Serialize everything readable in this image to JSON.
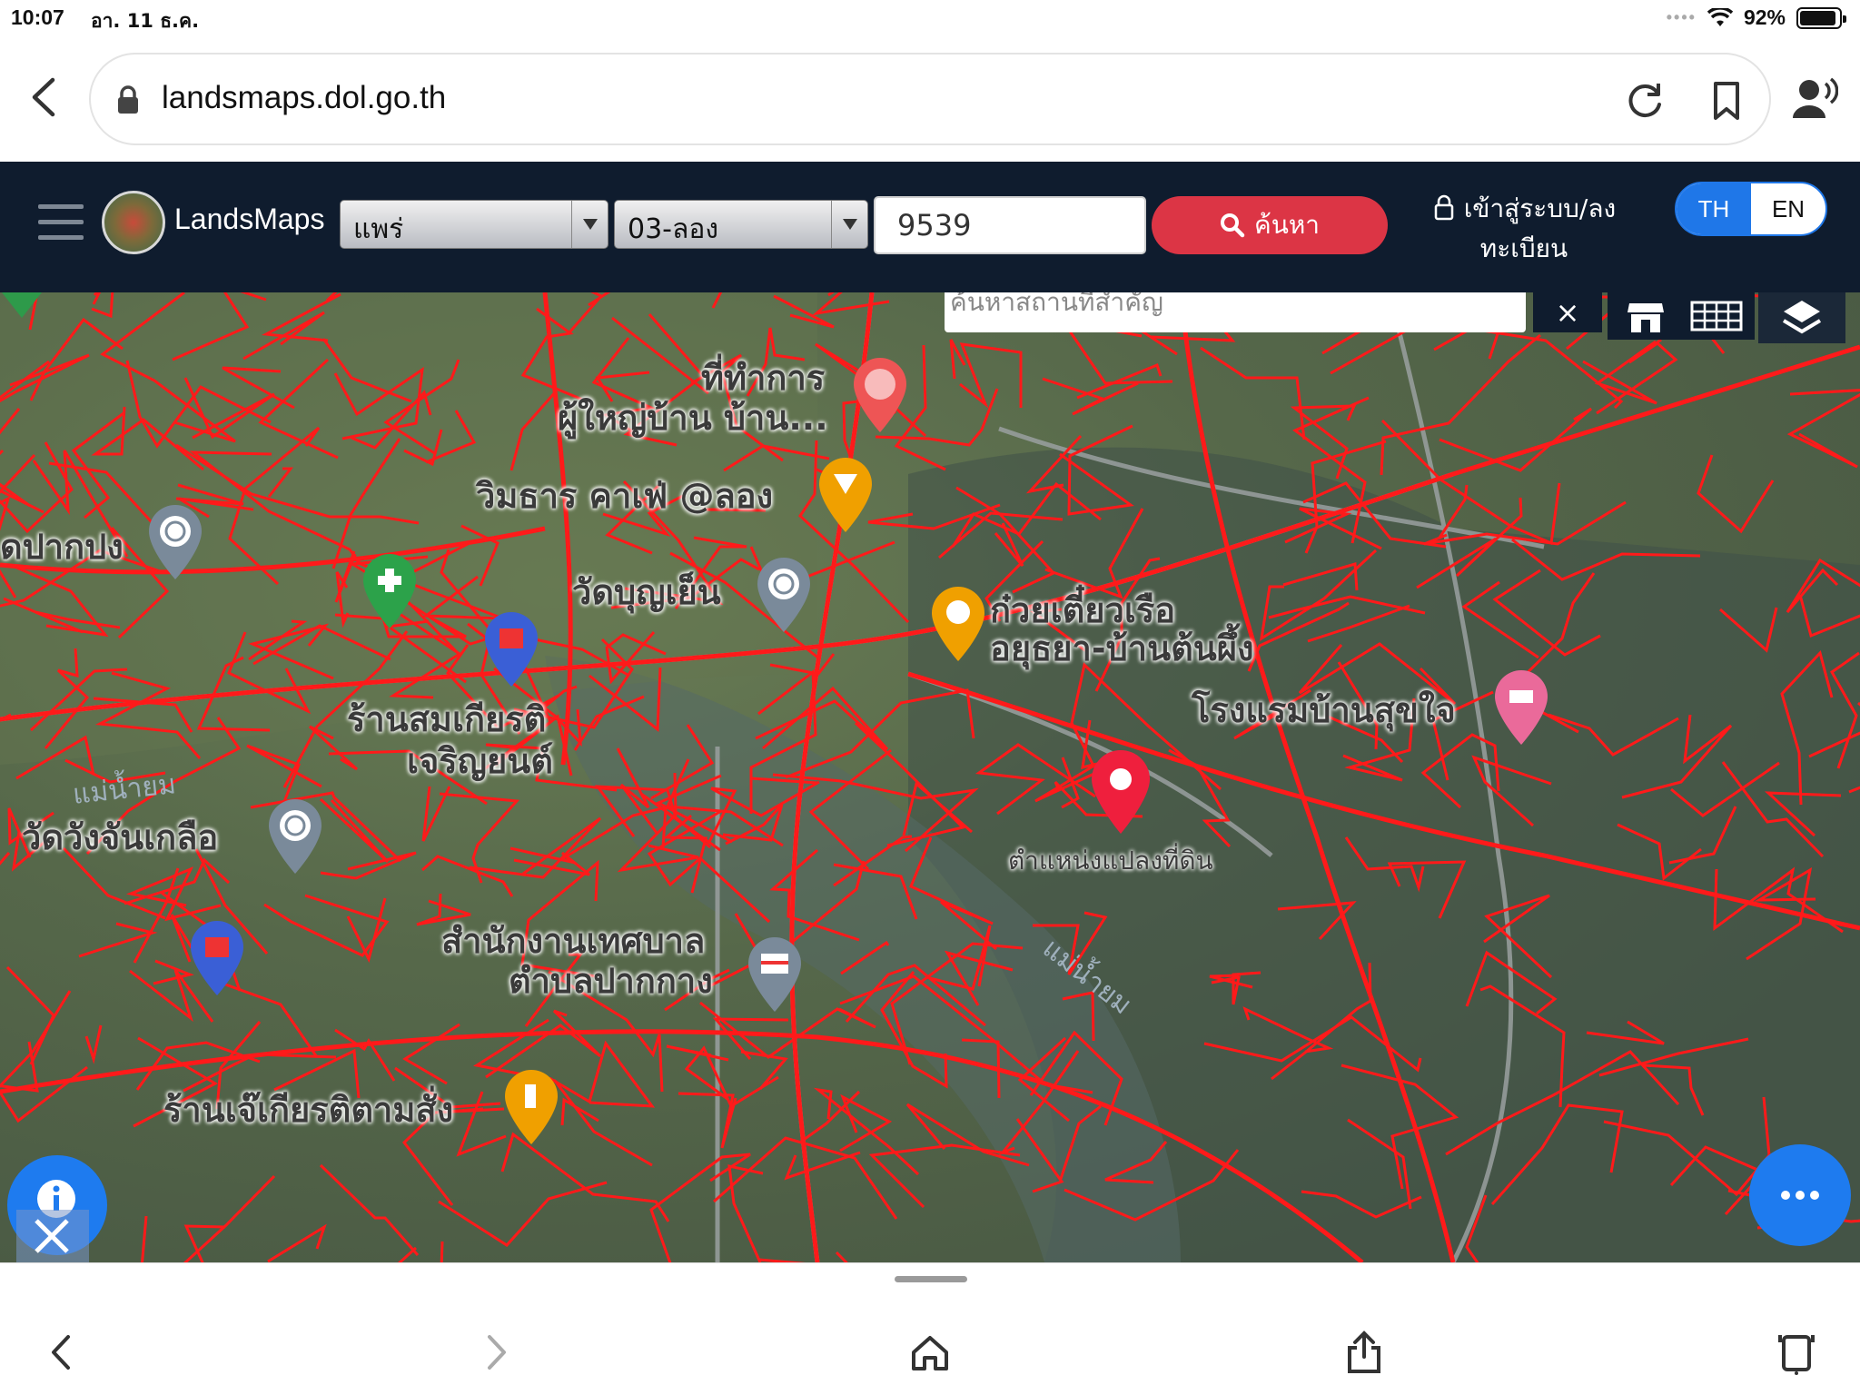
{
  "status_bar": {
    "time": "10:07",
    "date": "อา. 11 ธ.ค.",
    "battery": "92%",
    "battery_level": 0.92
  },
  "browser": {
    "url": "landsmaps.dol.go.th",
    "icons": [
      "back-icon",
      "lock-icon",
      "reload-icon",
      "bookmark-icon",
      "profile-icon"
    ]
  },
  "header": {
    "app_name": "LandsMaps",
    "province": "แพร่",
    "district": "03-ลอง",
    "parcel_number": "9539",
    "search_label": "ค้นหา",
    "login_label": "เข้าสู่ระบบ/ลงทะเบียน",
    "lang": {
      "th": "TH",
      "en": "EN",
      "active": "TH"
    }
  },
  "map": {
    "poi_search_placeholder": "ค้นหาสถานที่สำคัญ",
    "clear_label": "×",
    "marker_label": "ตำแหน่งแปลงที่ดิน",
    "places": [
      {
        "id": "village-head",
        "lines": [
          "ที่ทำการ",
          "ผู้ใหญ่บ้าน บ้าน..."
        ]
      },
      {
        "id": "cafe",
        "lines": [
          "วิมธาร คาเฟ่ @ลอง"
        ]
      },
      {
        "id": "temple-paknang",
        "lines": [
          "ดปากปง"
        ]
      },
      {
        "id": "wat-bunyuen",
        "lines": [
          "วัดบุญเย็น"
        ]
      },
      {
        "id": "noodle-shop",
        "lines": [
          "ก๋วยเตี๋ยวเรือ",
          "อยุธยา-บ้านต้นผึ้ง"
        ]
      },
      {
        "id": "hotel",
        "lines": [
          "โรงแรมบ้านสุขใจ"
        ]
      },
      {
        "id": "mechanic-shop",
        "lines": [
          "ร้านสมเกียรติ",
          "เจริญยนต์"
        ]
      },
      {
        "id": "wat-wangchan",
        "lines": [
          "วัดวังจันเกลือ"
        ]
      },
      {
        "id": "municipal-office",
        "lines": [
          "สำนักงานเทศบาล",
          "ตำบลปากกาง"
        ]
      },
      {
        "id": "noodle-order",
        "lines": [
          "ร้านเจ๊เกียรติตามสั่ง"
        ]
      }
    ],
    "rivers": [
      "แม่น้ำยม",
      "แม่น้ำยม"
    ],
    "colors": {
      "parcel_lines": "#ff1a1a",
      "accent_blue": "#1e7bef",
      "search_red": "#dc3545",
      "header_bg": "#0f1c2e"
    }
  },
  "bottom_bar": {
    "icons": [
      "back-icon",
      "forward-icon",
      "home-icon",
      "share-icon",
      "tabs-icon"
    ]
  }
}
